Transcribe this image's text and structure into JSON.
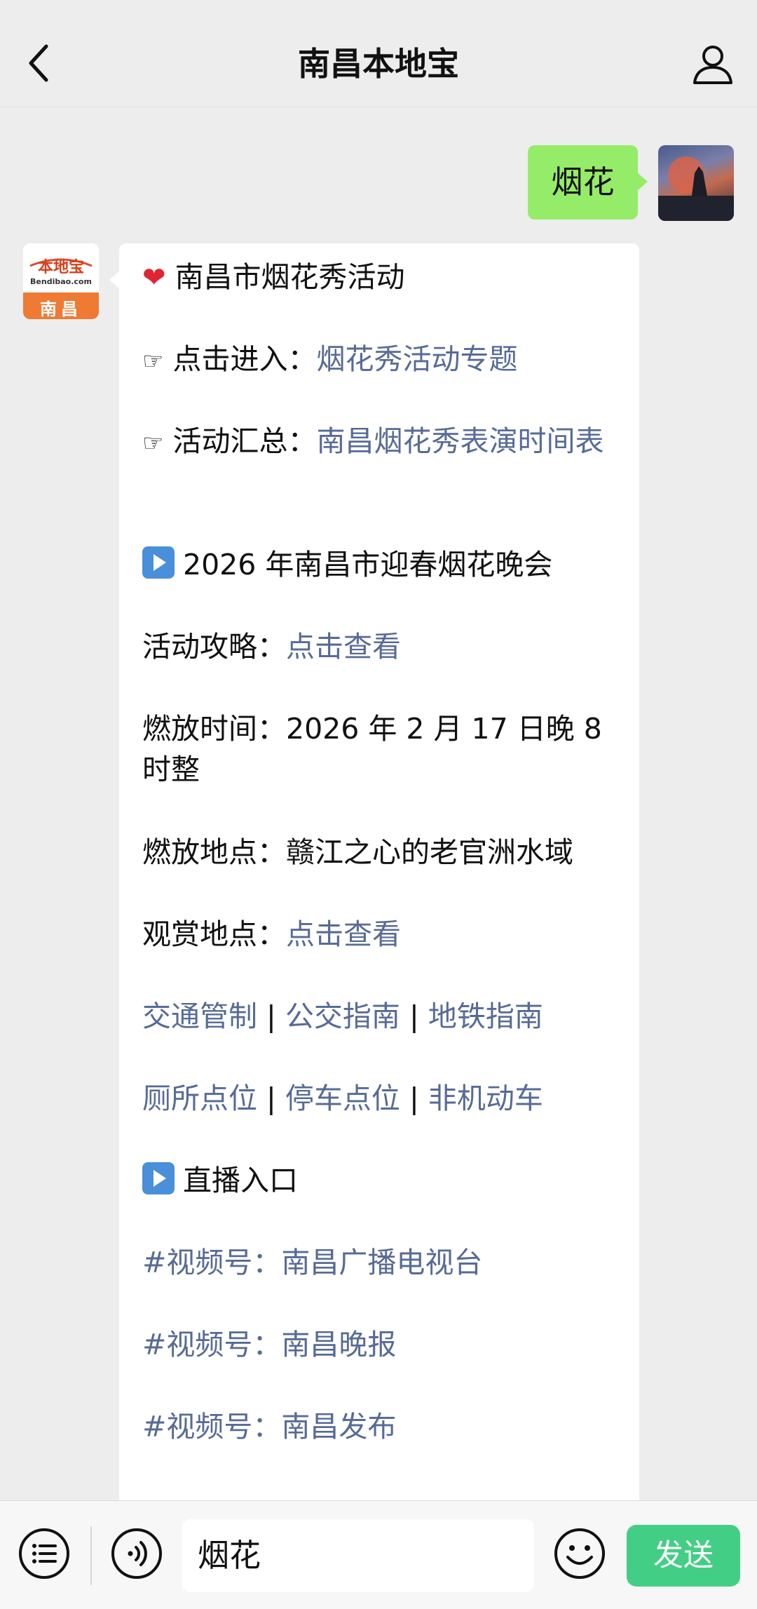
{
  "header": {
    "title": "南昌本地宝"
  },
  "outgoing": {
    "text": "烟花"
  },
  "bot_avatar": {
    "top_text": "本地宝",
    "sub_text": "Bendibao.com",
    "city": "南昌"
  },
  "message": {
    "heading": "南昌市烟花秀活动",
    "line1_label": "点击进入：",
    "line1_link": "烟花秀活动专题",
    "line2_label": "活动汇总：",
    "line2_link": "南昌烟花秀表演时间表",
    "section1": "2026 年南昌市迎春烟花晚会",
    "guide_label": "活动攻略：",
    "guide_link": "点击查看",
    "time_text": "燃放时间：2026 年 2 月 17 日晚 8 时整",
    "place_text": "燃放地点：赣江之心的老官洲水域",
    "view_label": "观赏地点：",
    "view_link": "点击查看",
    "links_row1": [
      "交通管制",
      "公交指南",
      "地铁指南"
    ],
    "links_row2": [
      "厕所点位",
      "停车点位",
      "非机动车"
    ],
    "separator": "|",
    "section2": "直播入口",
    "channel_prefix": "#视频号：",
    "channels": [
      "南昌广播电视台",
      "南昌晚报",
      "南昌发布"
    ]
  },
  "input": {
    "value": "烟花",
    "send_label": "发送"
  },
  "colors": {
    "link": "#576b95",
    "send": "#07c160",
    "outgoing_bubble": "#95ec69"
  }
}
